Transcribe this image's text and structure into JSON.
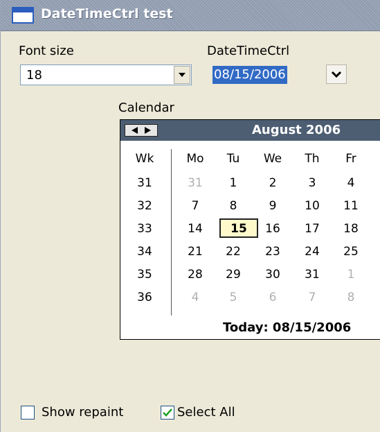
{
  "window": {
    "title": "DateTimeCtrl test"
  },
  "font_size": {
    "label": "Font size",
    "value": "18"
  },
  "datetime": {
    "label": "DateTimeCtrl",
    "value": "08/15/2006"
  },
  "calendar": {
    "label": "Calendar",
    "month_title": "August 2006",
    "headers": [
      "Wk",
      "Mo",
      "Tu",
      "We",
      "Th",
      "Fr"
    ],
    "rows": [
      {
        "wk": "31",
        "days": [
          "31",
          "1",
          "2",
          "3",
          "4"
        ]
      },
      {
        "wk": "32",
        "days": [
          "7",
          "8",
          "9",
          "10",
          "11"
        ]
      },
      {
        "wk": "33",
        "days": [
          "14",
          "15",
          "16",
          "17",
          "18"
        ]
      },
      {
        "wk": "34",
        "days": [
          "21",
          "22",
          "23",
          "24",
          "25"
        ]
      },
      {
        "wk": "35",
        "days": [
          "28",
          "29",
          "30",
          "31",
          "1"
        ]
      },
      {
        "wk": "36",
        "days": [
          "4",
          "5",
          "6",
          "7",
          "8"
        ]
      }
    ],
    "selected_day": "15",
    "today_text": "Today: 08/15/2006"
  },
  "options": {
    "show_repaint": {
      "label": "Show repaint",
      "checked": false
    },
    "select_all": {
      "label": "Select All",
      "checked": true
    }
  },
  "colors": {
    "title_bar": "#8e9aae",
    "calendar_header": "#4d5e73",
    "selection": "#316ac5",
    "today_highlight": "#fff9cc"
  }
}
